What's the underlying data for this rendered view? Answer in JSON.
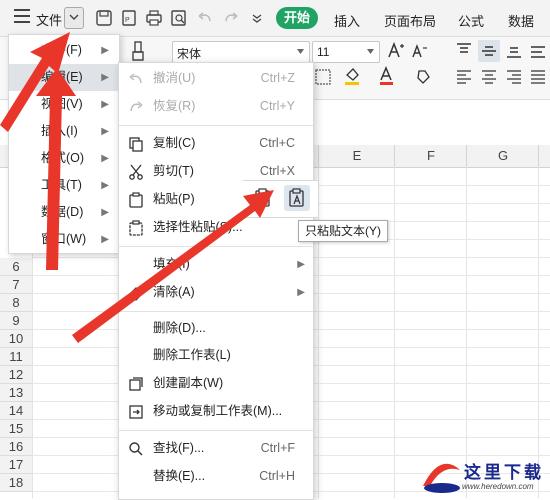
{
  "topbar": {
    "file_label": "文件",
    "tabs": [
      "开始",
      "插入",
      "页面布局",
      "公式",
      "数据"
    ]
  },
  "ribbon": {
    "font_name": "宋体",
    "font_size": "11"
  },
  "sheet": {
    "columns": [
      "E",
      "F",
      "G"
    ],
    "rows": [
      "6",
      "7",
      "8",
      "9",
      "10",
      "11",
      "12",
      "13",
      "14",
      "15",
      "16",
      "17",
      "18"
    ]
  },
  "file_submenu": {
    "items": [
      {
        "label": "文件(F)",
        "active": false
      },
      {
        "label": "编辑(E)",
        "active": true
      },
      {
        "label": "视图(V)",
        "active": false
      },
      {
        "label": "插入(I)",
        "active": false
      },
      {
        "label": "格式(O)",
        "active": false
      },
      {
        "label": "工具(T)",
        "active": false
      },
      {
        "label": "数据(D)",
        "active": false
      },
      {
        "label": "窗口(W)",
        "active": false
      }
    ]
  },
  "edit_menu": {
    "undo": {
      "label": "撤消(U)",
      "shortcut": "Ctrl+Z",
      "icon": "undo-icon"
    },
    "redo": {
      "label": "恢复(R)",
      "shortcut": "Ctrl+Y",
      "icon": "redo-icon"
    },
    "copy": {
      "label": "复制(C)",
      "shortcut": "Ctrl+C",
      "icon": "copy-icon"
    },
    "cut": {
      "label": "剪切(T)",
      "shortcut": "Ctrl+X",
      "icon": "scissors-icon"
    },
    "paste": {
      "label": "粘贴(P)",
      "icon": "paste-icon"
    },
    "paste_special": {
      "label": "选择性粘贴(S)...",
      "icon": "paste-special-icon"
    },
    "fill": {
      "label": "填充(I)"
    },
    "clear": {
      "label": "清除(A)",
      "icon": "eraser-icon"
    },
    "delete": {
      "label": "删除(D)..."
    },
    "delete_sheet": {
      "label": "删除工作表(L)"
    },
    "duplicate": {
      "label": "创建副本(W)",
      "icon": "duplicate-icon"
    },
    "move_copy": {
      "label": "移动或复制工作表(M)...",
      "icon": "move-sheet-icon"
    },
    "find": {
      "label": "查找(F)...",
      "shortcut": "Ctrl+F",
      "icon": "search-icon"
    },
    "replace": {
      "label": "替换(E)...",
      "shortcut": "Ctrl+H"
    }
  },
  "paste_panel": {
    "tooltip": "只粘贴文本(Y)"
  },
  "watermark": {
    "title": "这里下载",
    "url": "www.heredown.com"
  },
  "colors": {
    "accent_green": "#21a366",
    "arrow_red": "#e8362a",
    "watermark_blue": "#1a2a8c"
  }
}
